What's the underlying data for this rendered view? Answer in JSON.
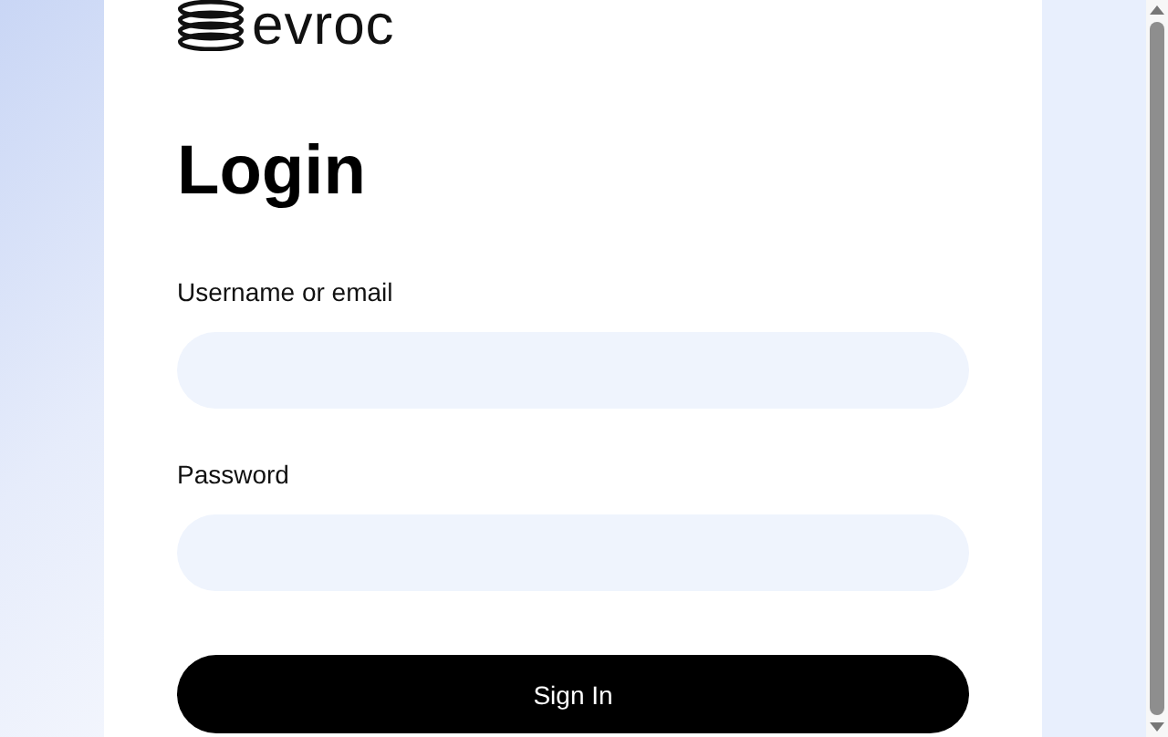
{
  "logo": {
    "text": "evroc"
  },
  "title": "Login",
  "fields": [
    {
      "label": "Username or email"
    },
    {
      "label": "Password"
    }
  ],
  "submit": {
    "label": "Sign In"
  }
}
